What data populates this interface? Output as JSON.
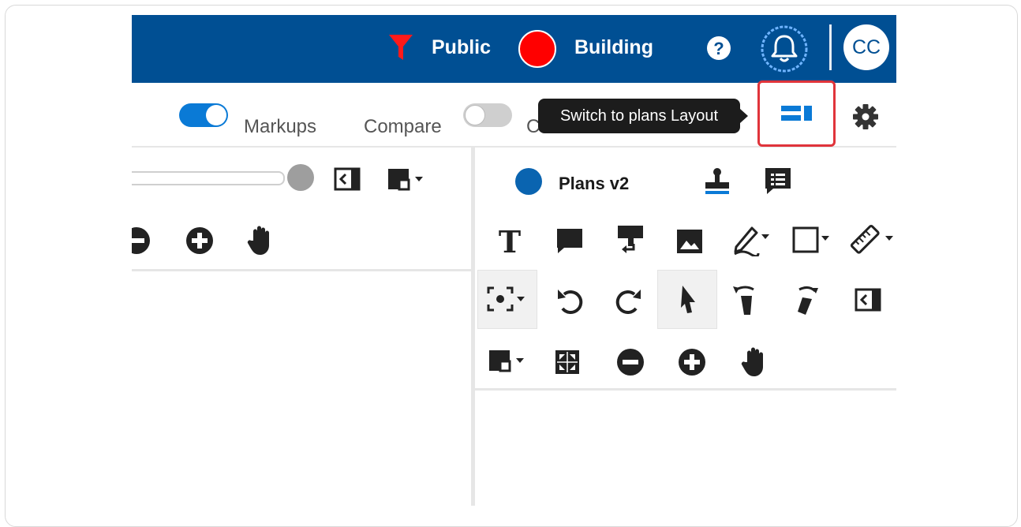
{
  "topbar": {
    "filter_label": "Public",
    "status_label": "Building",
    "avatar_initials": "CC"
  },
  "toolbar": {
    "markups_label": "Markups",
    "markups_toggle_on": true,
    "compare_label": "Compare",
    "compare_toggle_on": false,
    "tooltip": "Switch to plans Layout"
  },
  "right_panel": {
    "plans_label": "Plans v2",
    "plans_dot_color": "#0a64b0"
  },
  "colors": {
    "brand_blue": "#004f93",
    "accent_blue": "#0a7ad6",
    "red": "#ff0000",
    "highlight_red": "#e0343b",
    "icon_dark": "#222222"
  },
  "icons": {
    "topbar": [
      "filter-icon",
      "status-dot-icon",
      "help-icon",
      "notification-bell-icon"
    ],
    "toolbar": [
      "layout-switch-icon",
      "settings-gear-icon"
    ],
    "left_tools": [
      "slider",
      "panel-toggle-icon",
      "page-select-icon",
      "zoom-out-icon",
      "zoom-in-icon",
      "pan-hand-icon"
    ],
    "right_tools_row1": [
      "stamp-icon",
      "notes-icon"
    ],
    "right_tools_row2": [
      "text-tool-icon",
      "comment-icon",
      "callout-icon",
      "image-icon",
      "pen-icon",
      "rectangle-icon",
      "measure-icon"
    ],
    "right_tools_row3": [
      "capture-icon",
      "undo-icon",
      "redo-icon",
      "select-arrow-icon",
      "rotate-left-icon",
      "rotate-right-icon",
      "panel-toggle-icon"
    ],
    "right_tools_row4": [
      "page-select-icon",
      "fit-screen-icon",
      "zoom-out-icon",
      "zoom-in-icon",
      "pan-hand-icon"
    ]
  }
}
